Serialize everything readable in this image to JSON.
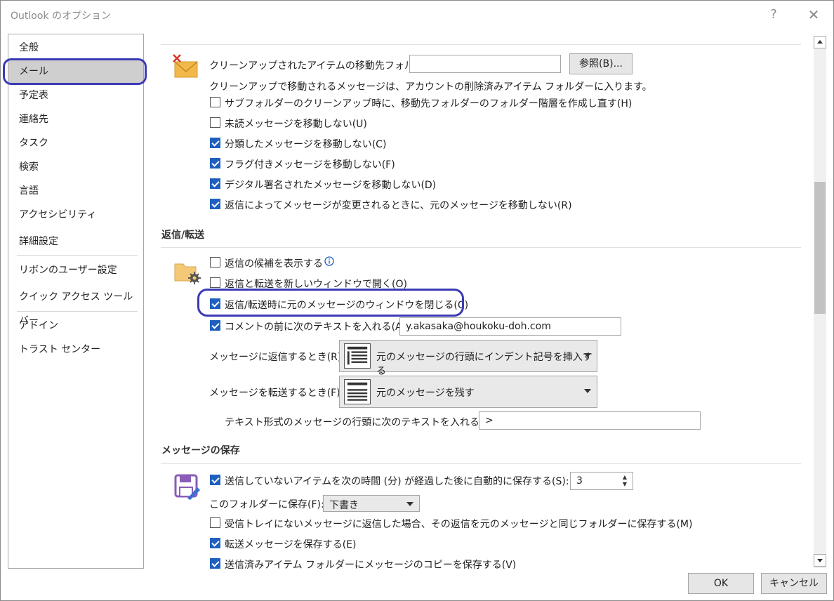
{
  "window": {
    "title": "Outlook のオプション",
    "help_icon": "?",
    "close_icon": "✕"
  },
  "sidebar": {
    "items": [
      {
        "label": "全般"
      },
      {
        "label": "メール"
      },
      {
        "label": "予定表"
      },
      {
        "label": "連絡先"
      },
      {
        "label": "タスク"
      },
      {
        "label": "検索"
      },
      {
        "label": "言語"
      },
      {
        "label": "アクセシビリティ"
      },
      {
        "label": "詳細設定"
      },
      {
        "label": "リボンのユーザー設定"
      },
      {
        "label": "クイック アクセス ツール バー"
      },
      {
        "label": "アドイン"
      },
      {
        "label": "トラスト センター"
      }
    ],
    "selected": "メール"
  },
  "cleanup": {
    "folder_label": "クリーンアップされたアイテムの移動先フォルダー:",
    "folder_value": "",
    "browse_label": "参照(B)...",
    "note": "クリーンアップで移動されるメッセージは、アカウントの削除済みアイテム フォルダーに入ります。",
    "options": [
      {
        "label": "サブフォルダーのクリーンアップ時に、移動先フォルダーのフォルダー階層を作成し直す(H)",
        "checked": false
      },
      {
        "label": "未読メッセージを移動しない(U)",
        "checked": false
      },
      {
        "label": "分類したメッセージを移動しない(C)",
        "checked": true
      },
      {
        "label": "フラグ付きメッセージを移動しない(F)",
        "checked": true
      },
      {
        "label": "デジタル署名されたメッセージを移動しない(D)",
        "checked": true
      },
      {
        "label": "返信によってメッセージが変更されるときに、元のメッセージを移動しない(R)",
        "checked": true
      }
    ]
  },
  "reply": {
    "heading": "返信/転送",
    "options": [
      {
        "label": "返信の候補を表示する",
        "checked": false
      },
      {
        "label": "返信と転送を新しいウィンドウで開く(O)",
        "checked": false
      },
      {
        "label": "返信/転送時に元のメッセージのウィンドウを閉じる(C)",
        "checked": true
      },
      {
        "label": "コメントの前に次のテキストを入れる(A):",
        "checked": true
      }
    ],
    "comment_value": "y.akasaka@houkoku-doh.com",
    "reply_label": "メッセージに返信するとき(R):",
    "reply_value": "元のメッセージの行頭にインデント記号を挿入する",
    "forward_label": "メッセージを転送するとき(F):",
    "forward_value": "元のメッセージを残す",
    "prefix_label": "テキスト形式のメッセージの行頭に次のテキストを入れる(P):",
    "prefix_value": ">"
  },
  "save": {
    "heading": "メッセージの保存",
    "autosave_label": "送信していないアイテムを次の時間 (分) が経過した後に自動的に保存する(S):",
    "autosave_checked": true,
    "autosave_value": "3",
    "folder_label": "このフォルダーに保存(F):",
    "folder_value": "下書き",
    "options": [
      {
        "label": "受信トレイにないメッセージに返信した場合、その返信を元のメッセージと同じフォルダーに保存する(M)",
        "checked": false
      },
      {
        "label": "転送メッセージを保存する(E)",
        "checked": true
      },
      {
        "label": "送信済みアイテム フォルダーにメッセージのコピーを保存する(V)",
        "checked": true
      }
    ]
  },
  "footer": {
    "ok_label": "OK",
    "cancel_label": "キャンセル"
  },
  "colors": {
    "accent": "#1f5fbf",
    "annotation_ring": "#3b3bb5"
  }
}
